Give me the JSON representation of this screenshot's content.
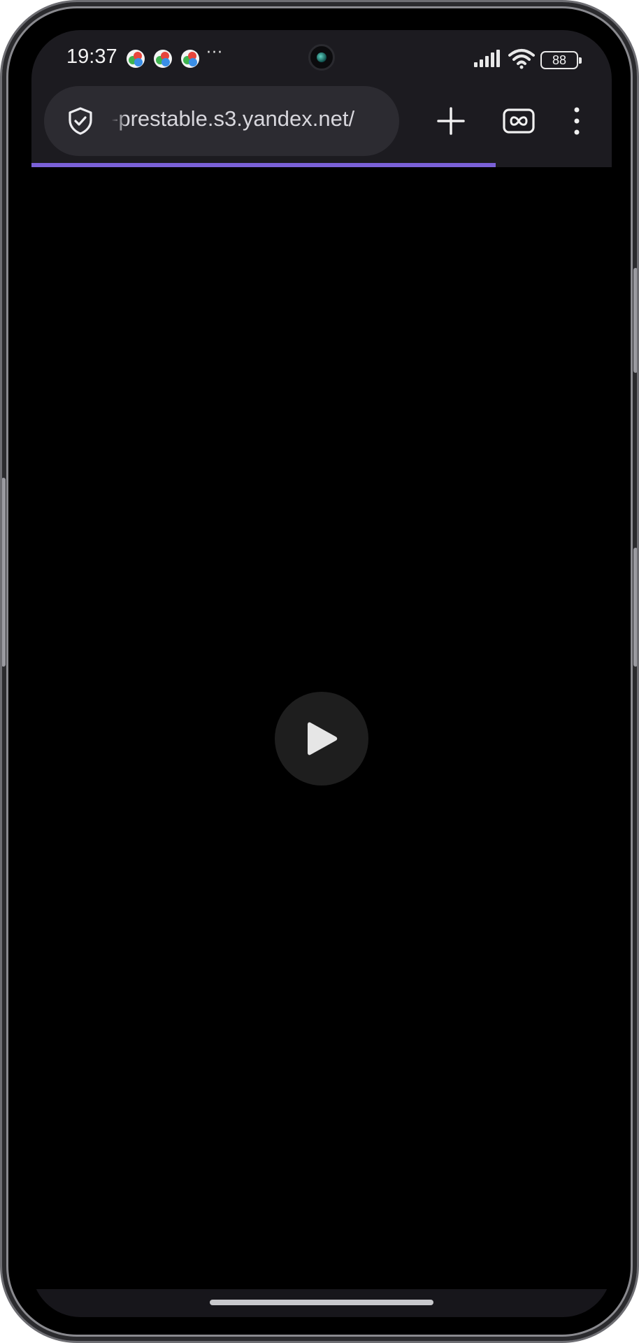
{
  "status_bar": {
    "time": "19:37",
    "notification_icons": [
      "app-notification-icon",
      "app-notification-icon",
      "app-notification-icon"
    ],
    "more_indicator": "···",
    "battery_level": "88",
    "signal_icon": "cellular-signal-icon",
    "wifi_icon": "wifi-icon"
  },
  "browser": {
    "url": "-prestable.s3.yandex.net/",
    "security_icon": "shield-check-icon",
    "new_tab_icon": "plus-icon",
    "tabs_icon": "tab-switcher-icon",
    "menu_icon": "more-vertical-icon",
    "load_progress_percent": 80,
    "accent_color": "#7b61d8"
  },
  "video": {
    "play_icon": "play-icon"
  }
}
